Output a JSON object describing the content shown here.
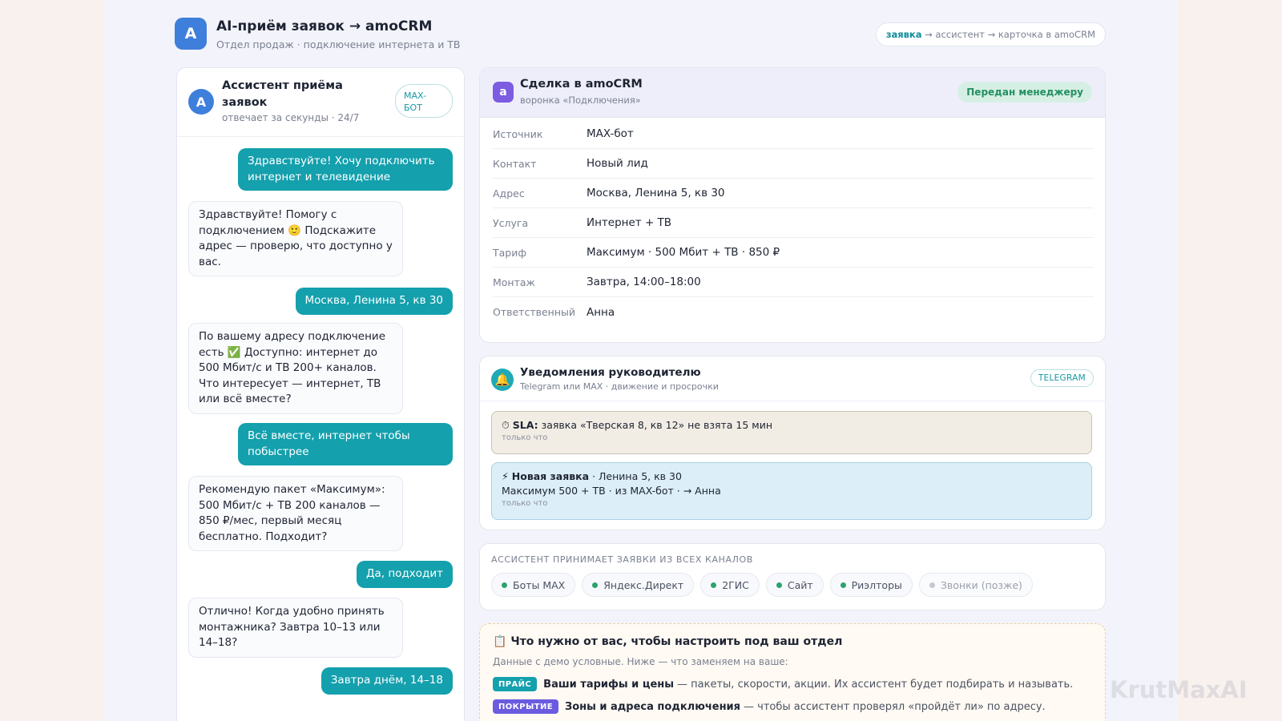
{
  "header": {
    "logo_letter": "A",
    "title": "AI-приём заявок → amoCRM",
    "subtitle": "Отдел продаж · подключение интернета и ТВ",
    "flow": {
      "step1": "заявка",
      "step2": " → ассистент → ",
      "step3": "карточка в amoCRM"
    }
  },
  "chat": {
    "avatar_letter": "A",
    "title": "Ассистент приёма заявок",
    "subtitle": "отвечает за секунды · 24/7",
    "badge": "MAX-БОТ",
    "messages": [
      {
        "side": "out",
        "text": "Здравствуйте! Хочу подключить интернет и телевидение"
      },
      {
        "side": "in",
        "text": "Здравствуйте! Помогу с подключением 🙂 Подскажите адрес — проверю, что доступно у вас."
      },
      {
        "side": "out",
        "text": "Москва, Ленина 5, кв 30"
      },
      {
        "side": "in",
        "text": "По вашему адресу подключение есть ✅ Доступно: интернет до 500 Мбит/с и ТВ 200+ каналов. Что интересует — интернет, ТВ или всё вместе?"
      },
      {
        "side": "out",
        "text": "Всё вместе, интернет чтобы побыстрее"
      },
      {
        "side": "in",
        "text": "Рекомендую пакет «Максимум»: 500 Мбит/с + ТВ 200 каналов — 850 ₽/мес, первый месяц бесплатно. Подходит?"
      },
      {
        "side": "out",
        "text": "Да, подходит"
      },
      {
        "side": "in",
        "text": "Отлично! Когда удобно принять монтажника? Завтра 10–13 или 14–18?"
      },
      {
        "side": "out",
        "text": "Завтра днём, 14–18"
      }
    ]
  },
  "deal": {
    "icon_letter": "a",
    "title": "Сделка в amoCRM",
    "subtitle": "воронка «Подключения»",
    "status": "Передан менеджеру",
    "fields": [
      {
        "label": "Источник",
        "value": "MAX-бот"
      },
      {
        "label": "Контакт",
        "value": "Новый лид"
      },
      {
        "label": "Адрес",
        "value": "Москва, Ленина 5, кв 30"
      },
      {
        "label": "Услуга",
        "value": "Интернет + ТВ"
      },
      {
        "label": "Тариф",
        "value": "Максимум · 500 Мбит + ТВ · 850 ₽"
      },
      {
        "label": "Монтаж",
        "value": "Завтра, 14:00–18:00"
      },
      {
        "label": "Ответственный",
        "value": "Анна"
      }
    ]
  },
  "notifications": {
    "title": "Уведомления руководителю",
    "subtitle": "Telegram или MAX · движение и просрочки",
    "badge": "TELEGRAM",
    "sla": {
      "icon": "⏱",
      "label": "SLA:",
      "text": " заявка «Тверская 8, кв 12» не взята 15 мин",
      "time": "только что"
    },
    "new": {
      "icon": "⚡",
      "label": "Новая заявка",
      "text": " · Ленина 5, кв 30",
      "line2": "Максимум 500 + ТВ · из MAX-бот · → Анна",
      "time": "только что"
    }
  },
  "channels": {
    "title": "АССИСТЕНТ ПРИНИМАЕТ ЗАЯВКИ ИЗ ВСЕХ КАНАЛОВ",
    "items": [
      {
        "label": "Боты MAX",
        "active": true
      },
      {
        "label": "Яндекс.Директ",
        "active": true
      },
      {
        "label": "2ГИС",
        "active": true
      },
      {
        "label": "Сайт",
        "active": true
      },
      {
        "label": "Риэлторы",
        "active": true
      },
      {
        "label": "Звонки (позже)",
        "active": false
      }
    ]
  },
  "setup": {
    "icon": "📋",
    "title": "Что нужно от вас, чтобы настроить под ваш отдел",
    "subtitle": "Данные с демо условные. Ниже — что заменяем на ваше:",
    "items": [
      {
        "tag": "ПРАЙС",
        "bold": "Ваши тарифы и цены",
        "rest": "— пакеты, скорости, акции. Их ассистент будет подбирать и называть."
      },
      {
        "tag": "ПОКРЫТИЕ",
        "bold": "Зоны и адреса подключения",
        "rest": "— чтобы ассистент проверял «пройдёт ли» по адресу."
      }
    ]
  },
  "watermark": "KrutMaxAI"
}
